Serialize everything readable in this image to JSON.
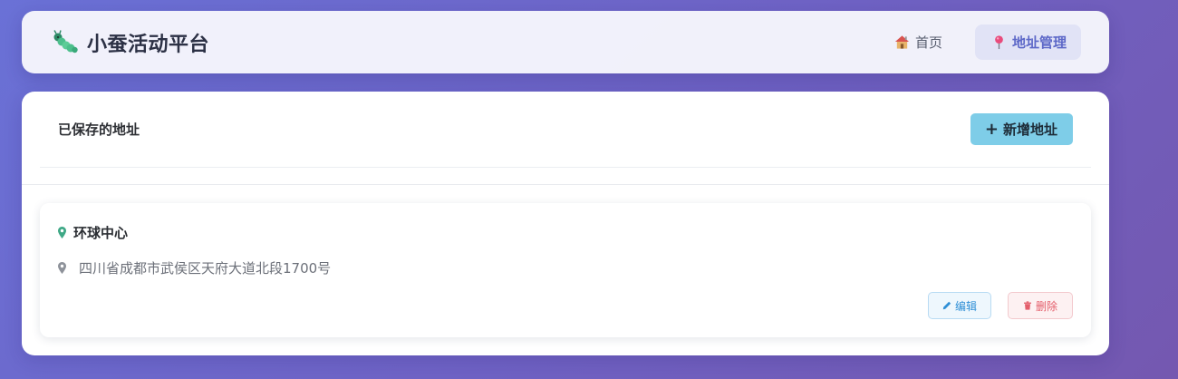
{
  "header": {
    "brand_icon": "caterpillar-icon",
    "brand_title": "小蚕活动平台",
    "nav": [
      {
        "label": "首页",
        "icon": "house-icon"
      },
      {
        "label": "地址管理",
        "icon": "map-pin-icon",
        "active": true
      }
    ]
  },
  "panel": {
    "title": "已保存的地址",
    "add_button": {
      "icon": "plus-icon",
      "label": "新增地址"
    }
  },
  "addresses": [
    {
      "name": "环球中心",
      "address": "四川省成都市武侯区天府大道北段1700号",
      "edit_label": "编辑",
      "delete_label": "删除"
    }
  ],
  "colors": {
    "accent": "#5d68c8",
    "add_button": "#7ecde8",
    "edit": "#2f8fd6",
    "delete": "#e45e6b",
    "location_pin": "#3fa886"
  }
}
